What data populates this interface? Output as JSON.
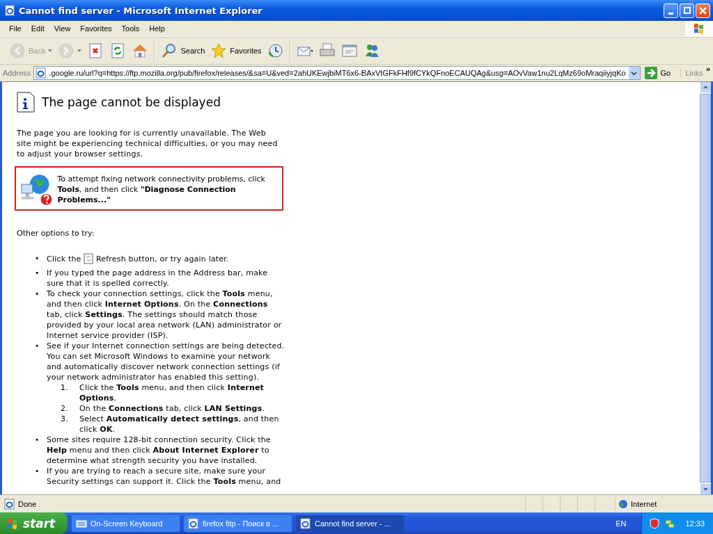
{
  "window": {
    "title": "Cannot find server - Microsoft Internet Explorer"
  },
  "menu": [
    "File",
    "Edit",
    "View",
    "Favorites",
    "Tools",
    "Help"
  ],
  "toolbar": [
    {
      "kind": "back",
      "label": "Back",
      "disabled": true
    },
    {
      "kind": "forward",
      "disabled": true
    },
    {
      "kind": "stop",
      "disabled": false
    },
    {
      "kind": "refresh",
      "disabled": false
    },
    {
      "kind": "home",
      "disabled": false
    },
    {
      "kind": "search",
      "label": "Search",
      "disabled": false
    },
    {
      "kind": "favorites",
      "label": "Favorites",
      "disabled": false
    },
    {
      "kind": "history",
      "disabled": false
    },
    {
      "kind": "mail",
      "disabled": false
    },
    {
      "kind": "print",
      "disabled": false
    },
    {
      "kind": "edit",
      "disabled": false
    },
    {
      "kind": "messenger",
      "disabled": false
    }
  ],
  "address": {
    "label": "Address",
    "value": ".google.ru/url?q=https://ftp.mozilla.org/pub/firefox/releases/&sa=U&ved=2ahUKEwjbiMT6x6-BAxVtGFkFHf9fCYkQFnoECAUQAg&usg=AOvVaw1nu2LqMz69oMraqiiyjqKo",
    "go": "Go",
    "links": "Links",
    "more": "»"
  },
  "page": {
    "heading": "The page cannot be displayed",
    "intro": "The page you are looking for is currently unavailable. The Web site might be experiencing technical difficulties, or you may need to adjust your browser settings.",
    "help": "To attempt fixing network connectivity problems, click **Tools**, and then click **\"Diagnose Connection Problems...\"**",
    "options_heading": "Other options to try:",
    "options": [
      {
        "kind": "icon-text",
        "bullet": "•",
        "before": "Click the",
        "after": "Refresh button, or try again later."
      },
      {
        "kind": "text",
        "bullet": "•",
        "text": "If you typed the page address in the Address bar, make sure that it is spelled correctly."
      },
      {
        "kind": "text",
        "bullet": "•",
        "text": "To check your connection settings, click the **Tools** menu, and then click **Internet Options**. On the **Connections** tab, click **Settings**. The settings should match those provided by your local area network (LAN) administrator or Internet service provider (ISP)."
      },
      {
        "kind": "text",
        "bullet": "•",
        "text": "See if your Internet connection settings are being detected. You can set Microsoft Windows to examine your network and automatically discover network connection settings (if your network administrator has enabled this setting).",
        "children": [
          {
            "number": "1.",
            "text": "Click the **Tools** menu, and then click **Internet Options**."
          },
          {
            "number": "2.",
            "text": "On the **Connections** tab, click **LAN Settings**."
          },
          {
            "number": "3.",
            "text": "Select **Automatically detect settings**, and then click **OK**."
          }
        ]
      },
      {
        "kind": "text",
        "bullet": "•",
        "text": "Some sites require 128-bit connection security. Click the **Help** menu and then click **About Internet Explorer** to determine what strength security you have installed."
      },
      {
        "kind": "text",
        "bullet": "•",
        "text": "If you are trying to reach a secure site, make sure your Security settings can support it. Click the **Tools** menu, and"
      }
    ]
  },
  "status_bar": {
    "text": "Done",
    "zone": "Internet"
  },
  "taskbar": {
    "start": "start",
    "tasks": [
      {
        "label": "On-Screen Keyboard",
        "kind": "keyboard",
        "selected": false
      },
      {
        "label": "firefox fitp - Поиск в ...",
        "kind": "ie",
        "selected": false
      },
      {
        "label": "Cannot find server - ...",
        "kind": "ie",
        "selected": true
      }
    ],
    "language": "EN",
    "clock": "12:33"
  }
}
